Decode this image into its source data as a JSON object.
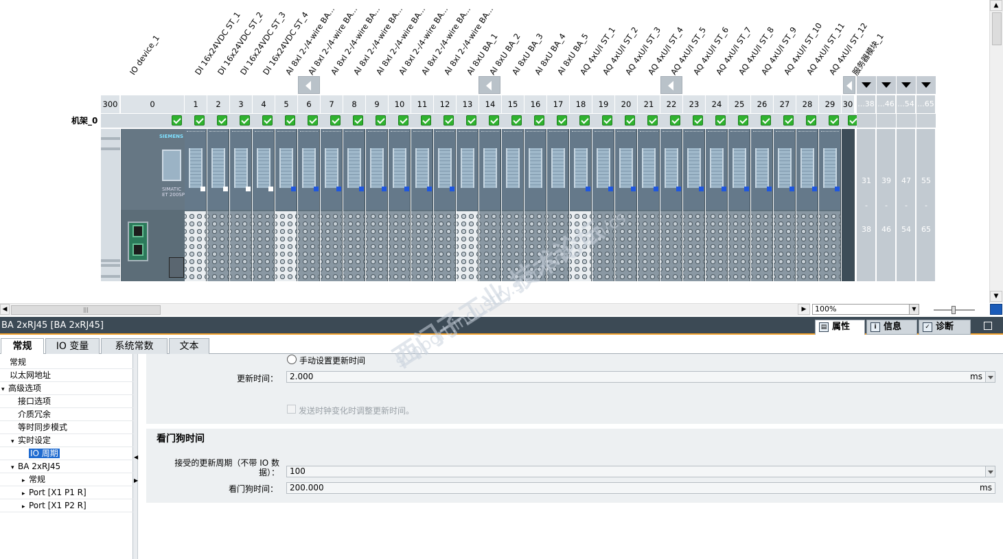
{
  "device_view": {
    "io_device_label": "IO device_1",
    "rack_label": "机架_0",
    "head_slot_numbers": [
      "300",
      "0"
    ],
    "slots": [
      {
        "num": "1",
        "name": "DI 16x24VDC ST_1",
        "term": "light"
      },
      {
        "num": "2",
        "name": "DI 16x24VDC ST_2",
        "term": "dark"
      },
      {
        "num": "3",
        "name": "DI 16x24VDC ST_3",
        "term": "dark"
      },
      {
        "num": "4",
        "name": "DI 16x24VDC ST_4",
        "term": "dark"
      },
      {
        "num": "5",
        "name": "AI 8xI 2-/4-wire BA...",
        "term": "light"
      },
      {
        "num": "6",
        "name": "AI 8xI 2-/4-wire BA...",
        "term": "dark"
      },
      {
        "num": "7",
        "name": "AI 8xI 2-/4-wire BA...",
        "term": "dark"
      },
      {
        "num": "8",
        "name": "AI 8xI 2-/4-wire BA...",
        "term": "dark"
      },
      {
        "num": "9",
        "name": "AI 8xI 2-/4-wire BA...",
        "term": "dark"
      },
      {
        "num": "10",
        "name": "AI 8xI 2-/4-wire BA...",
        "term": "dark"
      },
      {
        "num": "11",
        "name": "AI 8xI 2-/4-wire BA...",
        "term": "dark"
      },
      {
        "num": "12",
        "name": "AI 8xI 2-/4-wire BA...",
        "term": "dark"
      },
      {
        "num": "13",
        "name": "AI 8xU BA_1",
        "term": "light"
      },
      {
        "num": "14",
        "name": "AI 8xU BA_2",
        "term": "dark"
      },
      {
        "num": "15",
        "name": "AI 8xU BA_3",
        "term": "dark"
      },
      {
        "num": "16",
        "name": "AI 8xU BA_4",
        "term": "dark"
      },
      {
        "num": "17",
        "name": "AI 8xU BA_5",
        "term": "dark"
      },
      {
        "num": "18",
        "name": "AQ 4xU/I ST_1",
        "term": "light"
      },
      {
        "num": "19",
        "name": "AQ 4xU/I ST_2",
        "term": "dark"
      },
      {
        "num": "20",
        "name": "AQ 4xU/I ST_3",
        "term": "dark"
      },
      {
        "num": "21",
        "name": "AQ 4xU/I ST_4",
        "term": "dark"
      },
      {
        "num": "22",
        "name": "AQ 4xU/I ST_5",
        "term": "dark"
      },
      {
        "num": "23",
        "name": "AQ 4xU/I ST_6",
        "term": "dark"
      },
      {
        "num": "24",
        "name": "AQ 4xU/I ST_7",
        "term": "dark"
      },
      {
        "num": "25",
        "name": "AQ 4xU/I ST_8",
        "term": "dark"
      },
      {
        "num": "26",
        "name": "AQ 4xU/I ST_9",
        "term": "dark"
      },
      {
        "num": "27",
        "name": "AQ 4xU/I ST_10",
        "term": "dark"
      },
      {
        "num": "28",
        "name": "AQ 4xU/I ST_11",
        "term": "dark"
      },
      {
        "num": "29",
        "name": "AQ 4xU/I ST_12",
        "term": "dark"
      },
      {
        "num": "30",
        "name": "服务器模块_1",
        "term": "none"
      }
    ],
    "extra_columns": [
      {
        "header": "...38",
        "from": "31",
        "to": "38"
      },
      {
        "header": "...46",
        "from": "39",
        "to": "46"
      },
      {
        "header": "...54",
        "from": "47",
        "to": "54"
      },
      {
        "header": "...65",
        "from": "55",
        "to": "65"
      }
    ],
    "range_dash": "-",
    "head_logo": "SIEMENS",
    "head_name": "SIMATIC ET 200SP",
    "zoom_value": "100%",
    "hscroll_grip": "|||"
  },
  "properties": {
    "header_title": "BA 2xRJ45 [BA 2xRJ45]",
    "panel_tabs": [
      {
        "label": "属性",
        "icon": "properties-icon",
        "active": true
      },
      {
        "label": "信息",
        "icon": "info-icon",
        "active": false
      },
      {
        "label": "诊断",
        "icon": "diagnostics-icon",
        "active": false
      }
    ],
    "main_tabs": [
      "常规",
      "IO 变量",
      "系统常数",
      "文本"
    ],
    "tree": [
      {
        "label": "常规",
        "level": 0,
        "tri": ""
      },
      {
        "label": "以太网地址",
        "level": 0,
        "tri": ""
      },
      {
        "label": "高级选项",
        "level": 0,
        "tri": "▾"
      },
      {
        "label": "接口选项",
        "level": 1,
        "tri": ""
      },
      {
        "label": "介质冗余",
        "level": 1,
        "tri": ""
      },
      {
        "label": "等时同步模式",
        "level": 1,
        "tri": ""
      },
      {
        "label": "实时设定",
        "level": 1,
        "tri": "▾"
      },
      {
        "label": "IO 周期",
        "level": 2,
        "tri": "",
        "selected": true
      },
      {
        "label": "BA 2xRJ45",
        "level": 1,
        "tri": "▾"
      },
      {
        "label": "常规",
        "level": 2,
        "tri": "▸"
      },
      {
        "label": "Port [X1 P1 R]",
        "level": 2,
        "tri": "▸"
      },
      {
        "label": "Port [X1 P2 R]",
        "level": 2,
        "tri": "▸"
      }
    ],
    "update_section": {
      "radio_label": "手动设置更新时间",
      "update_time_label": "更新时间：",
      "update_time_value": "2.000",
      "update_time_unit": "ms",
      "checkbox_label": "发送时钟变化时调整更新时间。"
    },
    "watchdog_section": {
      "title": "看门狗时间",
      "accepted_label_line1": "接受的更新周期（不带 IO 数",
      "accepted_label_line2": "据）：",
      "accepted_value": "100",
      "watchdog_label": "看门狗时间：",
      "watchdog_value": "200.000",
      "watchdog_unit": "ms"
    }
  },
  "watermark": {
    "line1": "西门子工业 技术论坛",
    "line2": "support.industry.siemens.com/cs"
  }
}
